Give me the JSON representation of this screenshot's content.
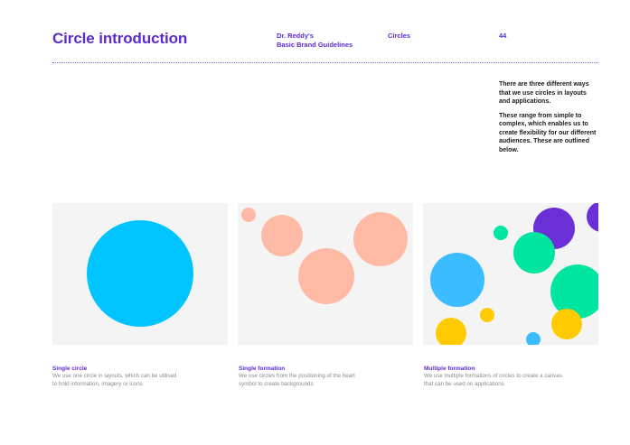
{
  "header": {
    "title": "Circle introduction",
    "brand_line1": "Dr. Reddy's",
    "brand_line2": "Basic Brand Guidelines",
    "section": "Circles",
    "page_number": "44"
  },
  "intro": {
    "paragraph1": "There are three different ways that we use circles in layouts and applications.",
    "paragraph2": "These range from simple to complex, which enables us to create flexibility for our different audiences. These are outlined below."
  },
  "examples": [
    {
      "title": "Single circle",
      "description": "We use one circle in layouts, which can be utilised to hold information, imagery or icons"
    },
    {
      "title": "Single formation",
      "description": "We use circles from the positioning of the heart symbol to create backgrounds"
    },
    {
      "title": "Multiple formation",
      "description": "We use multiple formations of circles to create a canvas that can be used on applications"
    }
  ],
  "colors": {
    "brand_purple": "#5b2bd0",
    "panel_bg": "#f4f4f4",
    "cyan": "#00c4ff",
    "peach": "#ffbaa5",
    "green": "#00e6a0",
    "sky_blue": "#3bbcff",
    "yellow": "#ffcb00",
    "violet": "#6a2fd6"
  }
}
